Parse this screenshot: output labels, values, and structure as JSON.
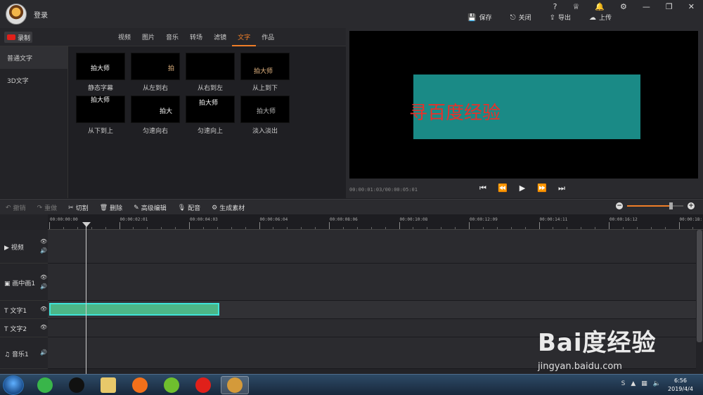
{
  "titlebar": {
    "login_label": "登录",
    "actions": [
      {
        "icon": "save-icon",
        "glyph": "💾",
        "label": "保存"
      },
      {
        "icon": "close-doc-icon",
        "glyph": "⎋",
        "label": "关闭"
      },
      {
        "icon": "export-icon",
        "glyph": "⇪",
        "label": "导出"
      },
      {
        "icon": "upload-icon",
        "glyph": "☁",
        "label": "上传"
      }
    ],
    "window_icons": [
      "?",
      "♕",
      "🔔",
      "⚙",
      "—",
      "❐",
      "✕"
    ]
  },
  "record_button": {
    "label": "录制"
  },
  "media_tabs": [
    "视频",
    "图片",
    "音乐",
    "转场",
    "滤镜",
    "文字",
    "作品"
  ],
  "active_tab_index": 5,
  "categories": [
    "普通文字",
    "3D文字"
  ],
  "active_category_index": 0,
  "text_effects": [
    {
      "label": "静态字幕",
      "preview": "拍大师"
    },
    {
      "label": "从左到右",
      "preview": "拍"
    },
    {
      "label": "从右到左",
      "preview": ""
    },
    {
      "label": "从上到下",
      "preview": "拍大师"
    },
    {
      "label": "从下到上",
      "preview": "拍大师"
    },
    {
      "label": "匀速向右",
      "preview": "拍大"
    },
    {
      "label": "匀速向上",
      "preview": "拍大师"
    },
    {
      "label": "淡入淡出",
      "preview": "拍大师"
    }
  ],
  "preview": {
    "overlay_text": "寻百度经验",
    "timecode": "00:00:01:03/00:00:05:01"
  },
  "toolbar": {
    "tools": [
      {
        "icon": "undo-icon",
        "glyph": "↶",
        "label": "撤销",
        "enabled": false
      },
      {
        "icon": "redo-icon",
        "glyph": "↷",
        "label": "重做",
        "enabled": false
      },
      {
        "icon": "scissors-icon",
        "glyph": "✂",
        "label": "切割",
        "enabled": true
      },
      {
        "icon": "trash-icon",
        "glyph": "🗑",
        "label": "删除",
        "enabled": true
      },
      {
        "icon": "pen-icon",
        "glyph": "✎",
        "label": "高级编辑",
        "enabled": true
      },
      {
        "icon": "microphone-icon",
        "glyph": "🎙",
        "label": "配音",
        "enabled": true
      },
      {
        "icon": "film-icon",
        "glyph": "⚙",
        "label": "生成素材",
        "enabled": true
      }
    ],
    "zoom_level": 0.78
  },
  "ruler_labels": [
    "00:00:00:00",
    "00:00:02:01",
    "00:00:04:03",
    "00:00:06:04",
    "00:00:08:06",
    "00:00:10:08",
    "00:00:12:09",
    "00:00:14:11",
    "00:00:16:12",
    "00:00:18:"
  ],
  "tracks": [
    {
      "icon": "video-icon",
      "glyph": "▶",
      "name": "视频",
      "eye": true,
      "speaker": true
    },
    {
      "icon": "pip-icon",
      "glyph": "▣",
      "name": "画中画1",
      "eye": true,
      "speaker": true
    },
    {
      "icon": "text-icon",
      "glyph": "T",
      "name": "文字1",
      "eye": true,
      "speaker": false
    },
    {
      "icon": "text-icon",
      "glyph": "T",
      "name": "文字2",
      "eye": true,
      "speaker": false
    },
    {
      "icon": "music-icon",
      "glyph": "♫",
      "name": "音乐1",
      "eye": false,
      "speaker": true
    }
  ],
  "watermark": {
    "brand": "Bai度经验",
    "url": "jingyan.baidu.com"
  },
  "taskbar": {
    "time": "6:56",
    "date": "2019/4/4",
    "apps": [
      {
        "name": "360-browser-icon",
        "color": "#39b54a"
      },
      {
        "name": "qq-icon",
        "color": "#111111"
      },
      {
        "name": "file-explorer-icon",
        "color": "#e8c86a"
      },
      {
        "name": "firefox-icon",
        "color": "#f2701a"
      },
      {
        "name": "media-player-icon",
        "color": "#6fbf2e"
      },
      {
        "name": "recorder-icon",
        "color": "#e0201a"
      },
      {
        "name": "paidashi-icon",
        "color": "#d49a3a"
      }
    ]
  }
}
